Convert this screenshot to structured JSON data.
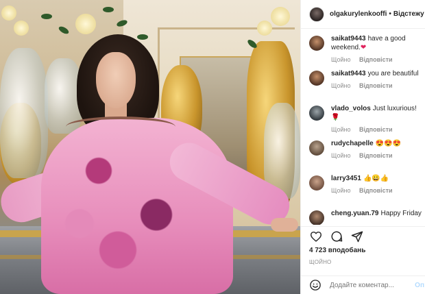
{
  "header": {
    "username": "olgakurylenkooffi",
    "separator": "•",
    "follow_label": "Відстежу"
  },
  "comments": [
    {
      "user": "saikat9443",
      "text": "have a good weekend.",
      "emoji": "❤",
      "time": "Щойно",
      "reply": "Відповісти"
    },
    {
      "user": "saikat9443",
      "text": "you are beautiful",
      "emoji": "",
      "time": "Щойно",
      "reply": "Відповісти"
    },
    {
      "user": "vlado_volos",
      "text": "Just luxurious!",
      "emoji": "🌹",
      "time": "Щойно",
      "reply": "Відповісти"
    },
    {
      "user": "rudychapelle",
      "text": "",
      "emoji": "😍😍😍",
      "time": "Щойно",
      "reply": "Відповісти"
    },
    {
      "user": "larry3451",
      "text": "",
      "emoji": "👍😀👍",
      "time": "Щойно",
      "reply": "Відповісти"
    },
    {
      "user": "cheng.yuan.79",
      "text": "Happy Friday",
      "emoji": "",
      "time": "",
      "reply": ""
    }
  ],
  "actions": {
    "like_icon": "heart-outline-icon",
    "comment_icon": "comment-bubble-icon",
    "share_icon": "paper-plane-icon"
  },
  "likes_text": "4 723 вподобань",
  "posted_time": "ЩОЙНО",
  "add_comment": {
    "emoji_icon": "smiley-icon",
    "placeholder": "Додайте коментар...",
    "post_label": "Оп"
  },
  "colors": {
    "text": "#262626",
    "muted": "#8e8e8e",
    "post_disabled": "#b3dbff",
    "heart": "#e0245e"
  }
}
